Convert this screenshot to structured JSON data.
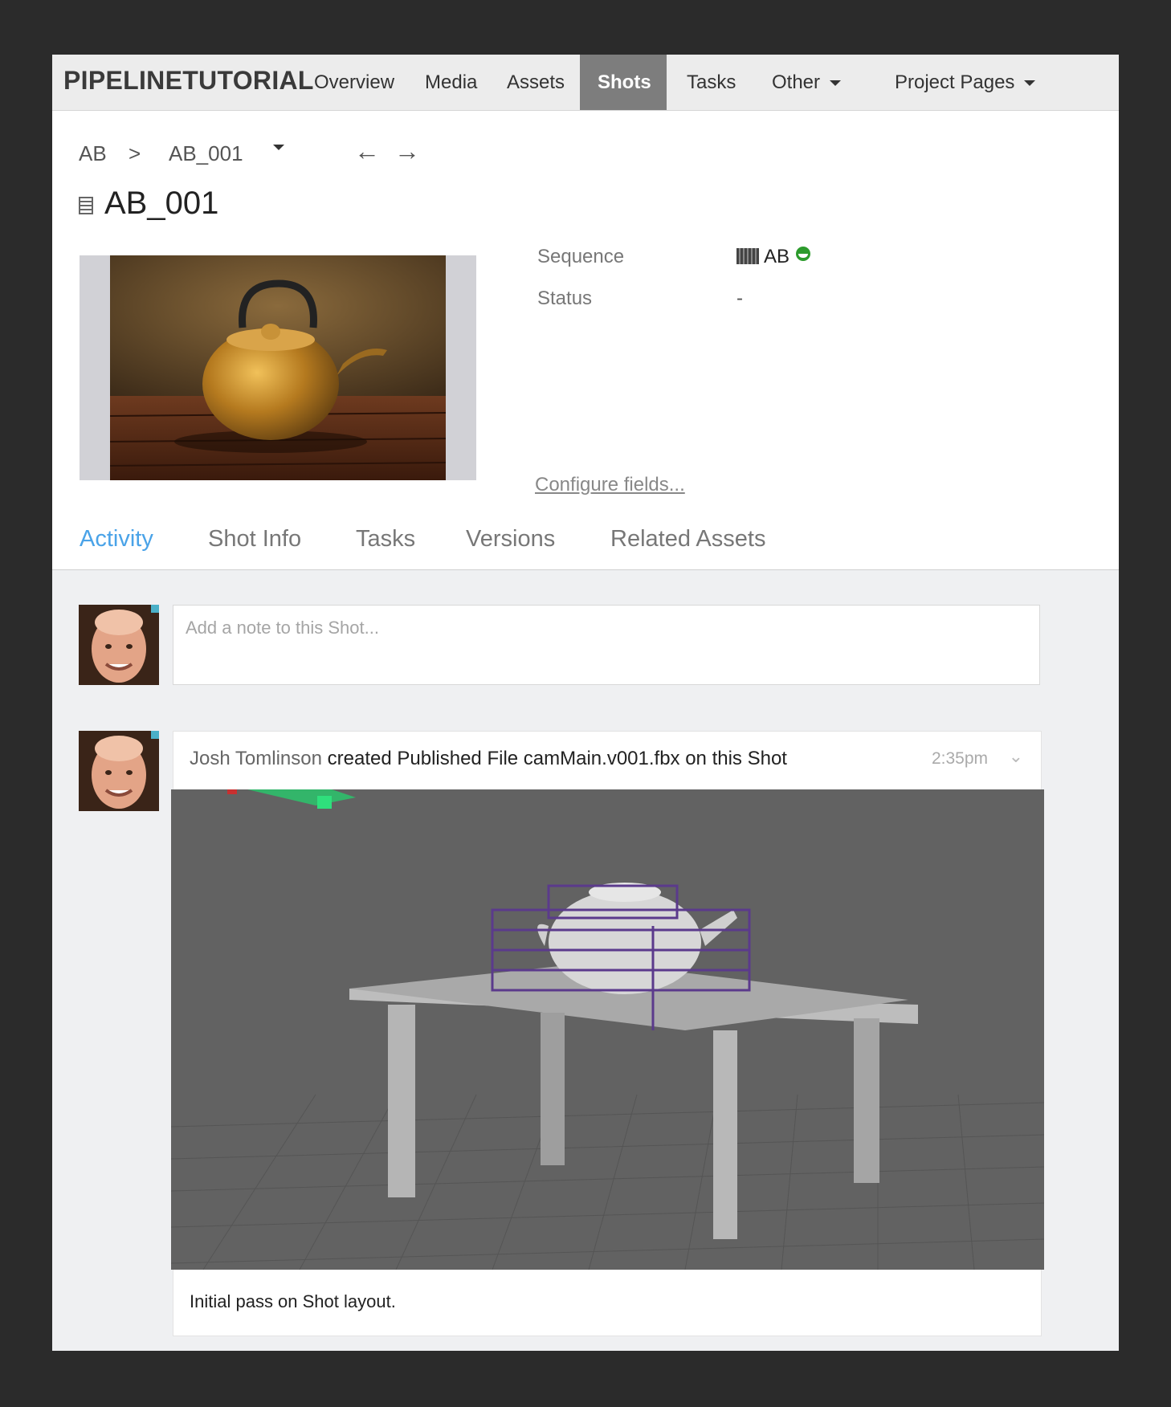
{
  "nav": {
    "brand": "PIPELINETUTORIAL",
    "items": [
      {
        "label": "Overview",
        "active": false
      },
      {
        "label": "Media",
        "active": false
      },
      {
        "label": "Assets",
        "active": false
      },
      {
        "label": "Shots",
        "active": true
      },
      {
        "label": "Tasks",
        "active": false
      },
      {
        "label": "Other",
        "active": false
      },
      {
        "label": "Project Pages",
        "active": false
      }
    ]
  },
  "breadcrumb": {
    "parent": "AB",
    "separator": ">",
    "current": "AB_001",
    "prev_arrow": "←",
    "next_arrow": "→"
  },
  "page": {
    "title": "AB_001",
    "thumbnail_icon": "film-icon"
  },
  "fields": {
    "sequence_label": "Sequence",
    "sequence_value": "AB",
    "status_label": "Status",
    "status_value": "-",
    "configure_link": "Configure fields..."
  },
  "tabs": [
    {
      "label": "Activity",
      "active": true
    },
    {
      "label": "Shot Info",
      "active": false
    },
    {
      "label": "Tasks",
      "active": false
    },
    {
      "label": "Versions",
      "active": false
    },
    {
      "label": "Related Assets",
      "active": false
    }
  ],
  "activity": {
    "note_placeholder": "Add a note to this Shot...",
    "entry": {
      "user": "Josh Tomlinson",
      "action": " created Published File camMain.v001.fbx on this Shot",
      "time": "2:35pm",
      "caption": "Initial pass on Shot layout."
    }
  },
  "colors": {
    "accent": "#4aa3e8",
    "nav_active_bg": "#7d7d7d",
    "status_green": "#2c9b2c"
  }
}
